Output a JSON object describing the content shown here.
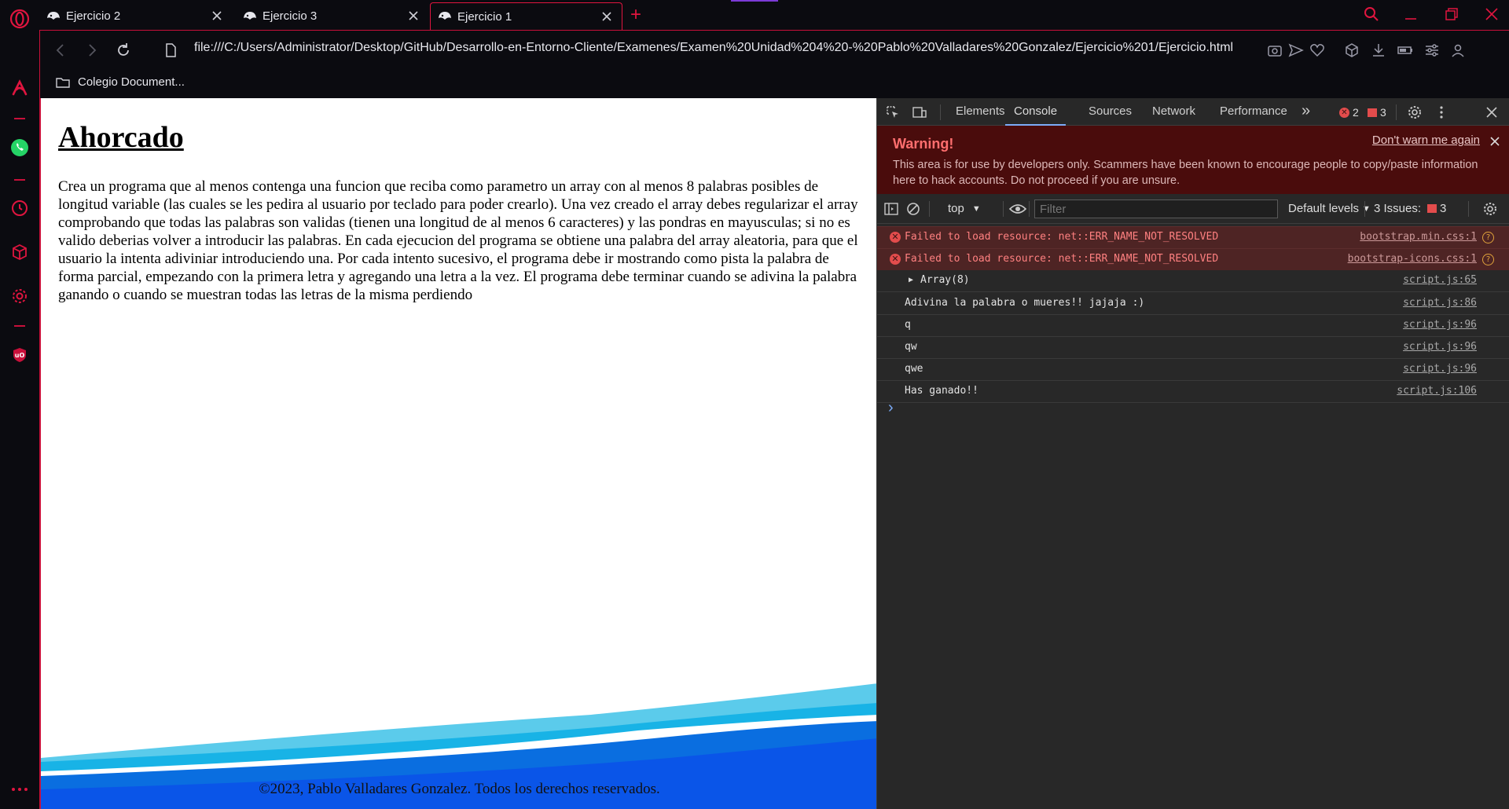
{
  "browser": {
    "tabs": [
      {
        "title": "Ejercicio 2",
        "active": false
      },
      {
        "title": "Ejercicio 3",
        "active": false
      },
      {
        "title": "Ejercicio 1",
        "active": true
      }
    ],
    "new_tab_symbol": "+",
    "url": "file:///C:/Users/Administrator/Desktop/GitHub/Desarrollo-en-Entorno-Cliente/Examenes/Examen%20Unidad%204%20-%20Pablo%20Valladares%20Gonzalez/Ejercicio%201/Ejercicio.html",
    "bookmarks": [
      {
        "label": "Colegio Document..."
      }
    ],
    "accent_color": "#e0153f"
  },
  "page": {
    "heading": "Ahorcado",
    "paragraph": "Crea un programa que al menos contenga una funcion que reciba como parametro un array con al menos 8 palabras posibles de longitud variable (las cuales se les pedira al usuario por teclado para poder crearlo). Una vez creado el array debes regularizar el array comprobando que todas las palabras son validas (tienen una longitud de al menos 6 caracteres) y las pondras en mayusculas; si no es valido deberias volver a introducir las palabras. En cada ejecucion del programa se obtiene una palabra del array aleatoria, para que el usuario la intenta adiviniar introduciendo una. Por cada intento sucesivo, el programa debe ir mostrando como pista la palabra de forma parcial, empezando con la primera letra y agregando una letra a la vez. El programa debe terminar cuando se adivina la palabra ganando o cuando se muestran todas las letras de la misma perdiendo",
    "footer": "©2023, Pablo Valladares Gonzalez. Todos los derechos reservados."
  },
  "devtools": {
    "tabs": [
      "Elements",
      "Console",
      "Sources",
      "Network",
      "Performance"
    ],
    "active_tab": "Console",
    "more_tabs_symbol": "»",
    "error_count": "2",
    "issue_count": "3",
    "warning": {
      "title": "Warning!",
      "text": "This area is for use by developers only. Scammers have been known to encourage people to copy/paste information here to hack accounts. Do not proceed if you are unsure.",
      "dont_warn": "Don't warn me again"
    },
    "console_toolbar": {
      "context": "top",
      "filter_placeholder": "Filter",
      "levels": "Default levels",
      "issues_label": "3 Issues:",
      "issues_count": "3"
    },
    "messages": [
      {
        "type": "error",
        "text": "Failed to load resource: net::ERR_NAME_NOT_RESOLVED",
        "source": "bootstrap.min.css:1"
      },
      {
        "type": "error",
        "text": "Failed to load resource: net::ERR_NAME_NOT_RESOLVED",
        "source": "bootstrap-icons.css:1"
      },
      {
        "type": "log",
        "text": "Array(8)",
        "source": "script.js:65"
      },
      {
        "type": "log",
        "text": "Adivina la palabra o mueres!! jajaja :)",
        "source": "script.js:86"
      },
      {
        "type": "log",
        "text": "q",
        "source": "script.js:96"
      },
      {
        "type": "log",
        "text": "qw",
        "source": "script.js:96"
      },
      {
        "type": "log",
        "text": "qwe",
        "source": "script.js:96"
      },
      {
        "type": "log",
        "text": "Has ganado!!",
        "source": "script.js:106"
      }
    ],
    "prompt_symbol": "›"
  }
}
